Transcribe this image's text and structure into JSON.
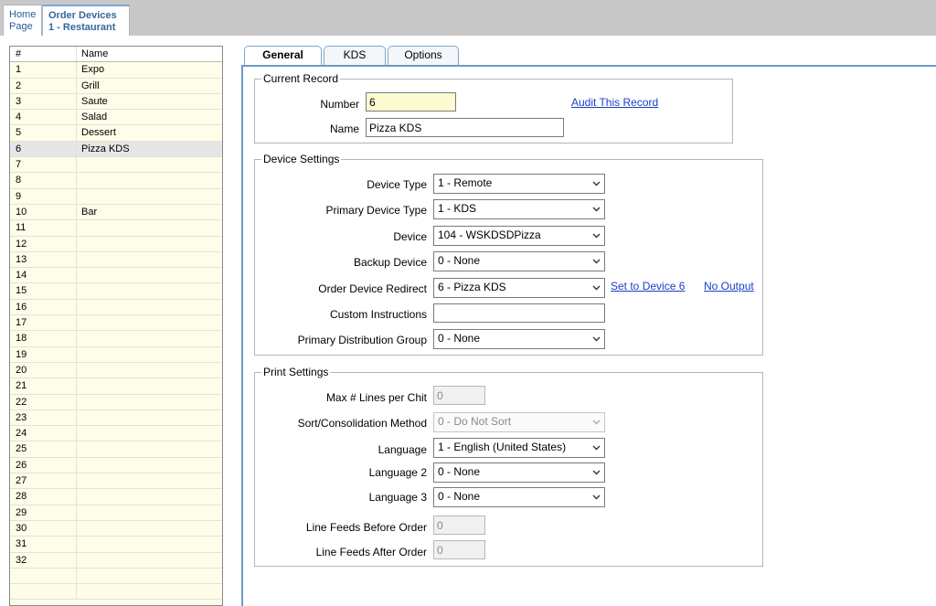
{
  "nav": {
    "home_line1": "Home",
    "home_line2": "Page",
    "devices_line1": "Order Devices",
    "devices_line2": "1 - Restaurant"
  },
  "list": {
    "col_num": "#",
    "col_name": "Name",
    "rows": [
      {
        "num": "1",
        "name": "Expo"
      },
      {
        "num": "2",
        "name": "Grill"
      },
      {
        "num": "3",
        "name": "Saute"
      },
      {
        "num": "4",
        "name": "Salad"
      },
      {
        "num": "5",
        "name": "Dessert"
      },
      {
        "num": "6",
        "name": "Pizza KDS"
      },
      {
        "num": "7",
        "name": ""
      },
      {
        "num": "8",
        "name": ""
      },
      {
        "num": "9",
        "name": ""
      },
      {
        "num": "10",
        "name": "Bar"
      },
      {
        "num": "11",
        "name": ""
      },
      {
        "num": "12",
        "name": ""
      },
      {
        "num": "13",
        "name": ""
      },
      {
        "num": "14",
        "name": ""
      },
      {
        "num": "15",
        "name": ""
      },
      {
        "num": "16",
        "name": ""
      },
      {
        "num": "17",
        "name": ""
      },
      {
        "num": "18",
        "name": ""
      },
      {
        "num": "19",
        "name": ""
      },
      {
        "num": "20",
        "name": ""
      },
      {
        "num": "21",
        "name": ""
      },
      {
        "num": "22",
        "name": ""
      },
      {
        "num": "23",
        "name": ""
      },
      {
        "num": "24",
        "name": ""
      },
      {
        "num": "25",
        "name": ""
      },
      {
        "num": "26",
        "name": ""
      },
      {
        "num": "27",
        "name": ""
      },
      {
        "num": "28",
        "name": ""
      },
      {
        "num": "29",
        "name": ""
      },
      {
        "num": "30",
        "name": ""
      },
      {
        "num": "31",
        "name": ""
      },
      {
        "num": "32",
        "name": ""
      },
      {
        "num": "",
        "name": ""
      },
      {
        "num": "",
        "name": ""
      }
    ]
  },
  "tabs": {
    "general": "General",
    "kds": "KDS",
    "options": "Options"
  },
  "current_record": {
    "title": "Current Record",
    "number_label": "Number",
    "number_value": "6",
    "name_label": "Name",
    "name_value": "Pizza KDS",
    "audit_link": "Audit This Record"
  },
  "device_settings": {
    "title": "Device Settings",
    "device_type_label": "Device Type",
    "device_type_value": "1 - Remote",
    "primary_device_type_label": "Primary Device Type",
    "primary_device_type_value": "1 - KDS",
    "device_label": "Device",
    "device_value": "104 - WSKDSDPizza",
    "backup_device_label": "Backup Device",
    "backup_device_value": "0 - None",
    "redirect_label": "Order Device Redirect",
    "redirect_value": "6 - Pizza KDS",
    "set_to_device_link": "Set to Device 6",
    "no_output_link": "No Output",
    "custom_instructions_label": "Custom Instructions",
    "custom_instructions_value": "",
    "distribution_group_label": "Primary Distribution Group",
    "distribution_group_value": "0 - None"
  },
  "print_settings": {
    "title": "Print Settings",
    "max_lines_label": "Max # Lines per Chit",
    "max_lines_value": "0",
    "sort_label": "Sort/Consolidation Method",
    "sort_value": "0 - Do Not Sort",
    "language_label": "Language",
    "language_value": "1 - English (United States)",
    "language2_label": "Language 2",
    "language2_value": "0 - None",
    "language3_label": "Language 3",
    "language3_value": "0 - None",
    "feeds_before_label": "Line Feeds Before Order",
    "feeds_before_value": "0",
    "feeds_after_label": "Line Feeds After Order",
    "feeds_after_value": "0"
  }
}
